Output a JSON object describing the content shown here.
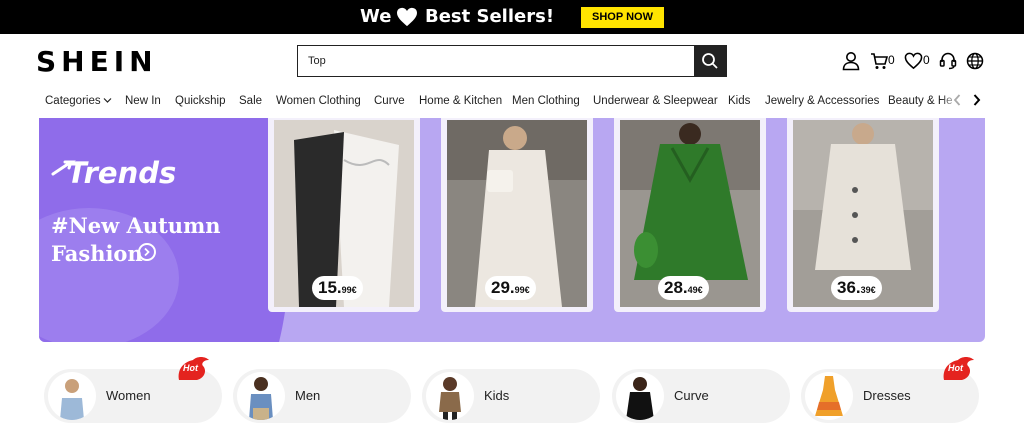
{
  "promo": {
    "text_before": "We",
    "text_after": "Best Sellers!",
    "button_label": "SHOP NOW"
  },
  "header": {
    "logo": "SHEIN",
    "search_value": "Top",
    "cart_count": "0",
    "wishlist_count": "0"
  },
  "nav": {
    "items": [
      "Categories",
      "New In",
      "Quickship",
      "Sale",
      "Women Clothing",
      "Curve",
      "Home & Kitchen",
      "Men Clothing",
      "Underwear & Sleepwear",
      "Kids",
      "Jewelry & Accessories",
      "Beauty & He"
    ]
  },
  "banner": {
    "title": "Trends",
    "subtitle_line1": "#New Autumn",
    "subtitle_line2": "Fashion",
    "products": [
      {
        "price_main": "15.",
        "price_dec": "99€"
      },
      {
        "price_main": "29.",
        "price_dec": "99€"
      },
      {
        "price_main": "28.",
        "price_dec": "49€"
      },
      {
        "price_main": "36.",
        "price_dec": "39€"
      }
    ]
  },
  "categories": [
    {
      "label": "Women",
      "badge": "Hot"
    },
    {
      "label": "Men",
      "badge": ""
    },
    {
      "label": "Kids",
      "badge": ""
    },
    {
      "label": "Curve",
      "badge": ""
    },
    {
      "label": "Dresses",
      "badge": "Hot"
    }
  ],
  "colors": {
    "promo_button": "#ffe400",
    "banner_purple": "#b8a7f2",
    "hot_badge": "#e4231f"
  }
}
